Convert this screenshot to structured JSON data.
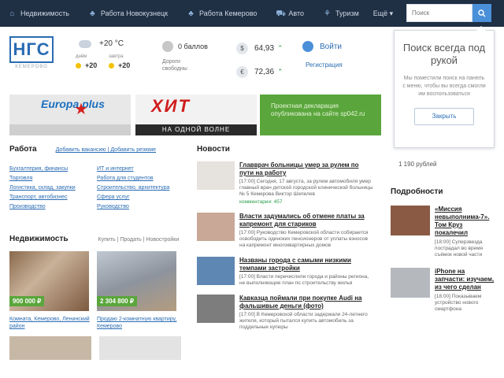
{
  "topnav": {
    "items": [
      {
        "icon": "house-icon",
        "label": "Недвижимость"
      },
      {
        "icon": "briefcase-icon",
        "label": "Работа Новокузнецк"
      },
      {
        "icon": "briefcase-icon",
        "label": "Работа Кемерово"
      },
      {
        "icon": "car-icon",
        "label": "Авто"
      },
      {
        "icon": "palm-icon",
        "label": "Туризм"
      }
    ],
    "more_label": "Ещё ▾",
    "search_placeholder": "Поиск"
  },
  "header": {
    "logo_text": "НГС",
    "logo_city": "КЕМЕРОВО",
    "weather": {
      "now": "+20 °C",
      "day_label": "днём",
      "day_value": "+20",
      "tomorrow_label": "завтра",
      "tomorrow_value": "+20"
    },
    "traffic": {
      "score": "0 баллов",
      "caption": "Дороги свободны"
    },
    "rates": [
      {
        "symbol": "$",
        "value": "64,93"
      },
      {
        "symbol": "€",
        "value": "72,36"
      }
    ],
    "login": {
      "enter": "Войти",
      "register": "Регистрация"
    }
  },
  "popup": {
    "title": "Поиск всегда под рукой",
    "text": "Мы поместили поиск на панель с меню, чтобы вы всегда смогли им воспользоваться",
    "button": "Закрыть"
  },
  "price_tail": "1 190 рублей",
  "banners": {
    "b1_brand": "Europa plus",
    "b2_brand": "ХИТ",
    "b2_tag": "НА ОДНОЙ ВОЛНЕ",
    "b3_text": "Проектная декларация опубликована на сайте sp042.ru"
  },
  "work": {
    "title": "Работа",
    "links": "Добавить вакансию | Добавить резюме",
    "col1": [
      "Бухгалтерия, финансы",
      "Торговля",
      "Логистика, склад, закупки",
      "Транспорт, автобизнес",
      "Производство"
    ],
    "col2": [
      "ИТ и интернет",
      "Работа для студентов",
      "Строительство, архитектура",
      "Сфера услуг",
      "Руководство"
    ]
  },
  "realty": {
    "title": "Недвижимость",
    "links": "Купить | Продать | Новостройки",
    "cards": [
      {
        "price": "900 000 ₽",
        "caption": "Комната, Кемерово, Ленинский район"
      },
      {
        "price": "2 304 800 ₽",
        "caption": "Продаю 2-комнатную квартиру, Кемерово"
      }
    ]
  },
  "news": {
    "title": "Новости",
    "items": [
      {
        "title": "Главврач больницы умер за рулем по пути на работу",
        "desc": "[17:00] Сегодня, 17 августа, за рулем автомобиля умер главный врач детской городской клинической больницы № 5 Кемерова Виктор Шепелев",
        "comments": "комментарии: 457"
      },
      {
        "title": "Власти задумались об отмене платы за капремонт для стариков",
        "desc": "[17:00] Руководство Кемеровской области собирается освободить одиноких пенсионеров от уплаты взносов на капремонт многоквартирных домов",
        "comments": ""
      },
      {
        "title": "Названы города с самыми низкими темпами застройки",
        "desc": "[17:00] Власти перечислили города и районы региона, не выполняющие план по строительству жилья",
        "comments": ""
      },
      {
        "title": "Кавказца поймали при покупке Audi на фальшивые деньги (фото)",
        "desc": "[17:00] В Кемеровской области задержали 24-летнего жителя, который пытался купить автомобиль за поддельные купюры",
        "comments": ""
      }
    ]
  },
  "details": {
    "title": "Подробности",
    "items": [
      {
        "title": "«Миссия невыполнима-7». Том Круз покалечил",
        "desc": "[18:00] Суперзвезда пострадал во время съёмок новой части"
      },
      {
        "title": "iPhone на запчасти: изучаем, из чего сделан",
        "desc": "[18:00] Показываем устройство нового смартфона"
      }
    ]
  }
}
